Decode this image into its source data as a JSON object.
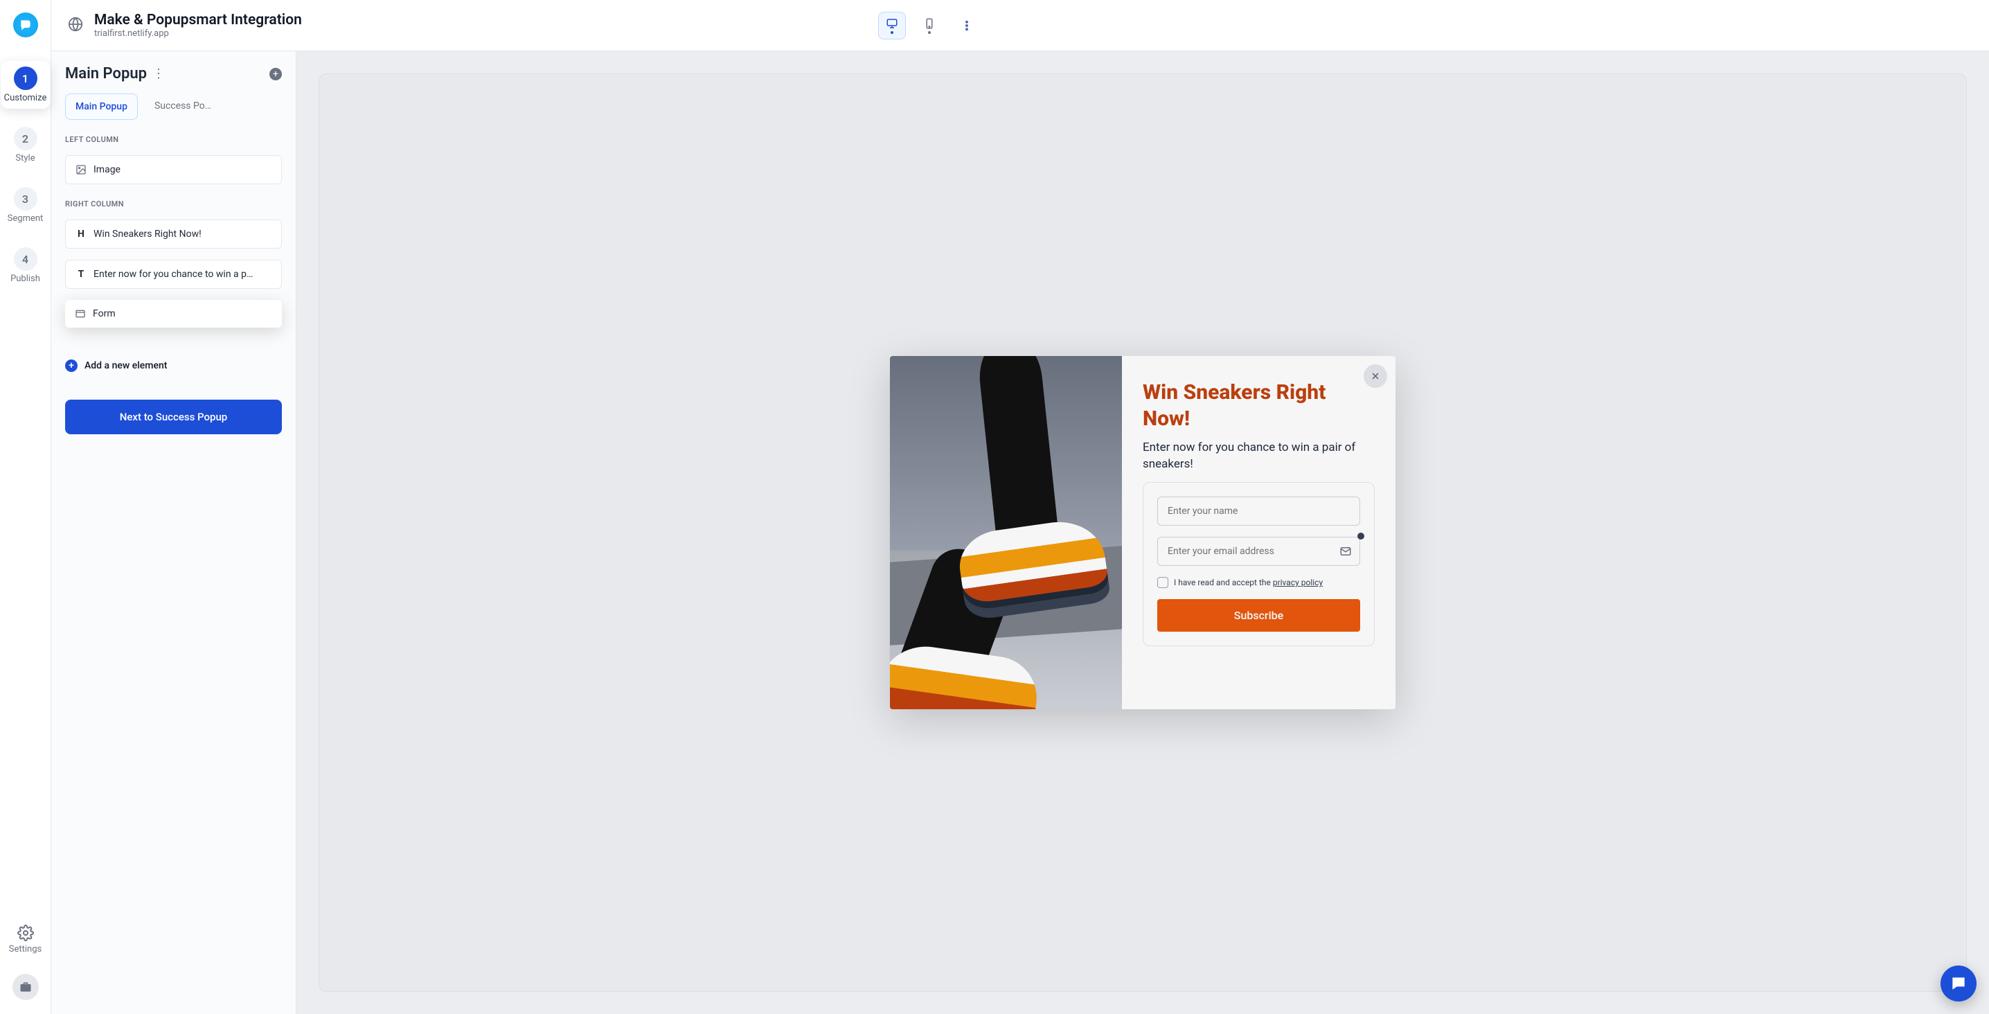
{
  "brand": {
    "name": "Popupsmart"
  },
  "header": {
    "title": "Make & Popupsmart Integration",
    "subtitle": "trialfirst.netlify.app",
    "device_desktop": "Desktop preview",
    "device_mobile": "Mobile preview",
    "more": "More"
  },
  "steps": [
    {
      "num": "1",
      "label": "Customize",
      "active": true
    },
    {
      "num": "2",
      "label": "Style",
      "active": false
    },
    {
      "num": "3",
      "label": "Segment",
      "active": false
    },
    {
      "num": "4",
      "label": "Publish",
      "active": false
    }
  ],
  "sidebar_footer": {
    "settings": "Settings",
    "briefcase": "Workspace"
  },
  "panel": {
    "title": "Main Popup",
    "menu": "Panel options",
    "add": "+",
    "tabs": {
      "main": "Main Popup",
      "success": "Success Po…"
    },
    "sections": {
      "left": "LEFT COLUMN",
      "right": "RIGHT COLUMN"
    },
    "elements": {
      "image": "Image",
      "heading": "Win Sneakers Right Now!",
      "text": "Enter now for you chance to win a p…",
      "form": "Form"
    },
    "add_element": "Add a new element",
    "next": "Next to Success Popup"
  },
  "popup": {
    "close": "Close",
    "heading": "Win Sneakers Right Now!",
    "subheading": "Enter now for you chance to win a pair of sneakers!",
    "name_placeholder": "Enter your name",
    "email_placeholder": "Enter your email address",
    "consent_prefix": "I have read and accept the ",
    "consent_link": "privacy policy",
    "submit": "Subscribe"
  },
  "chat": {
    "label": "Support chat"
  }
}
